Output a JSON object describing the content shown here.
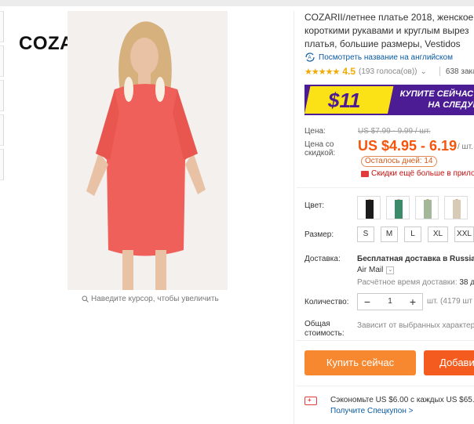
{
  "brand": {
    "logo_text": "COZARII"
  },
  "gallery": {
    "zoom_hint": "Наведите курсор, чтобы увеличить"
  },
  "product": {
    "title_lines": [
      "COZARII/летнее платье 2018, женское п",
      "короткими рукавами и круглым вырез",
      "платья, большие размеры, Vestidos"
    ],
    "translate_link": "Посмотреть название на английском",
    "rating": {
      "stars": 4.5,
      "value": "4.5",
      "votes": "(193 голоса(ов))",
      "orders": "638 зака"
    }
  },
  "promo": {
    "amount": "$11",
    "line1": "КУПИТЕ СЕЙЧАС И",
    "line2": "НА СЛЕДУЮ"
  },
  "price": {
    "price_label": "Цена:",
    "old_price": "US $7.99 - 9.99 / шт.",
    "discount_label": "Цена со скидкой:",
    "new_price": "US $4.95 - 6.19",
    "per_unit": "/ шт.",
    "days_left": "Осталось дней: 14",
    "more_discount": "Скидки ещё больше в прилож"
  },
  "options": {
    "color_label": "Цвет:",
    "colors": [
      {
        "name": "black",
        "hex": "#1b1b1b"
      },
      {
        "name": "green",
        "hex": "#3b8a6a"
      },
      {
        "name": "light-green",
        "hex": "#a3b79a"
      },
      {
        "name": "beige",
        "hex": "#d8cbb6"
      }
    ],
    "size_label": "Размер:",
    "sizes": [
      "S",
      "M",
      "L",
      "XL",
      "XXL"
    ]
  },
  "shipping": {
    "label": "Доставка:",
    "title": "Бесплатная доставка в Russian",
    "method": "Air Mail",
    "time_label": "Расчётное время доставки:",
    "time_value": "38 д"
  },
  "quantity": {
    "label": "Количество:",
    "value": "1",
    "minus": "−",
    "plus": "+",
    "available": "шт. (4179 шт"
  },
  "total": {
    "label": "Общая стоимость:",
    "note": "Зависит от выбранных характер"
  },
  "actions": {
    "buy_now": "Купить сейчас",
    "add_to_cart": "Добави"
  },
  "coupon": {
    "icon_text": "+",
    "save_text": "Сэкономьте US $6.00 с каждых US $65.00",
    "link": "Получите Спецкупон >"
  },
  "colors": {
    "accent_orange": "#f5550c",
    "buy_button": "#f7882f",
    "cart_button": "#f45b1e",
    "promo_purple": "#4b1c93",
    "promo_yellow": "#fbe216",
    "link_blue": "#0b5ba3",
    "star": "#f2a900"
  }
}
